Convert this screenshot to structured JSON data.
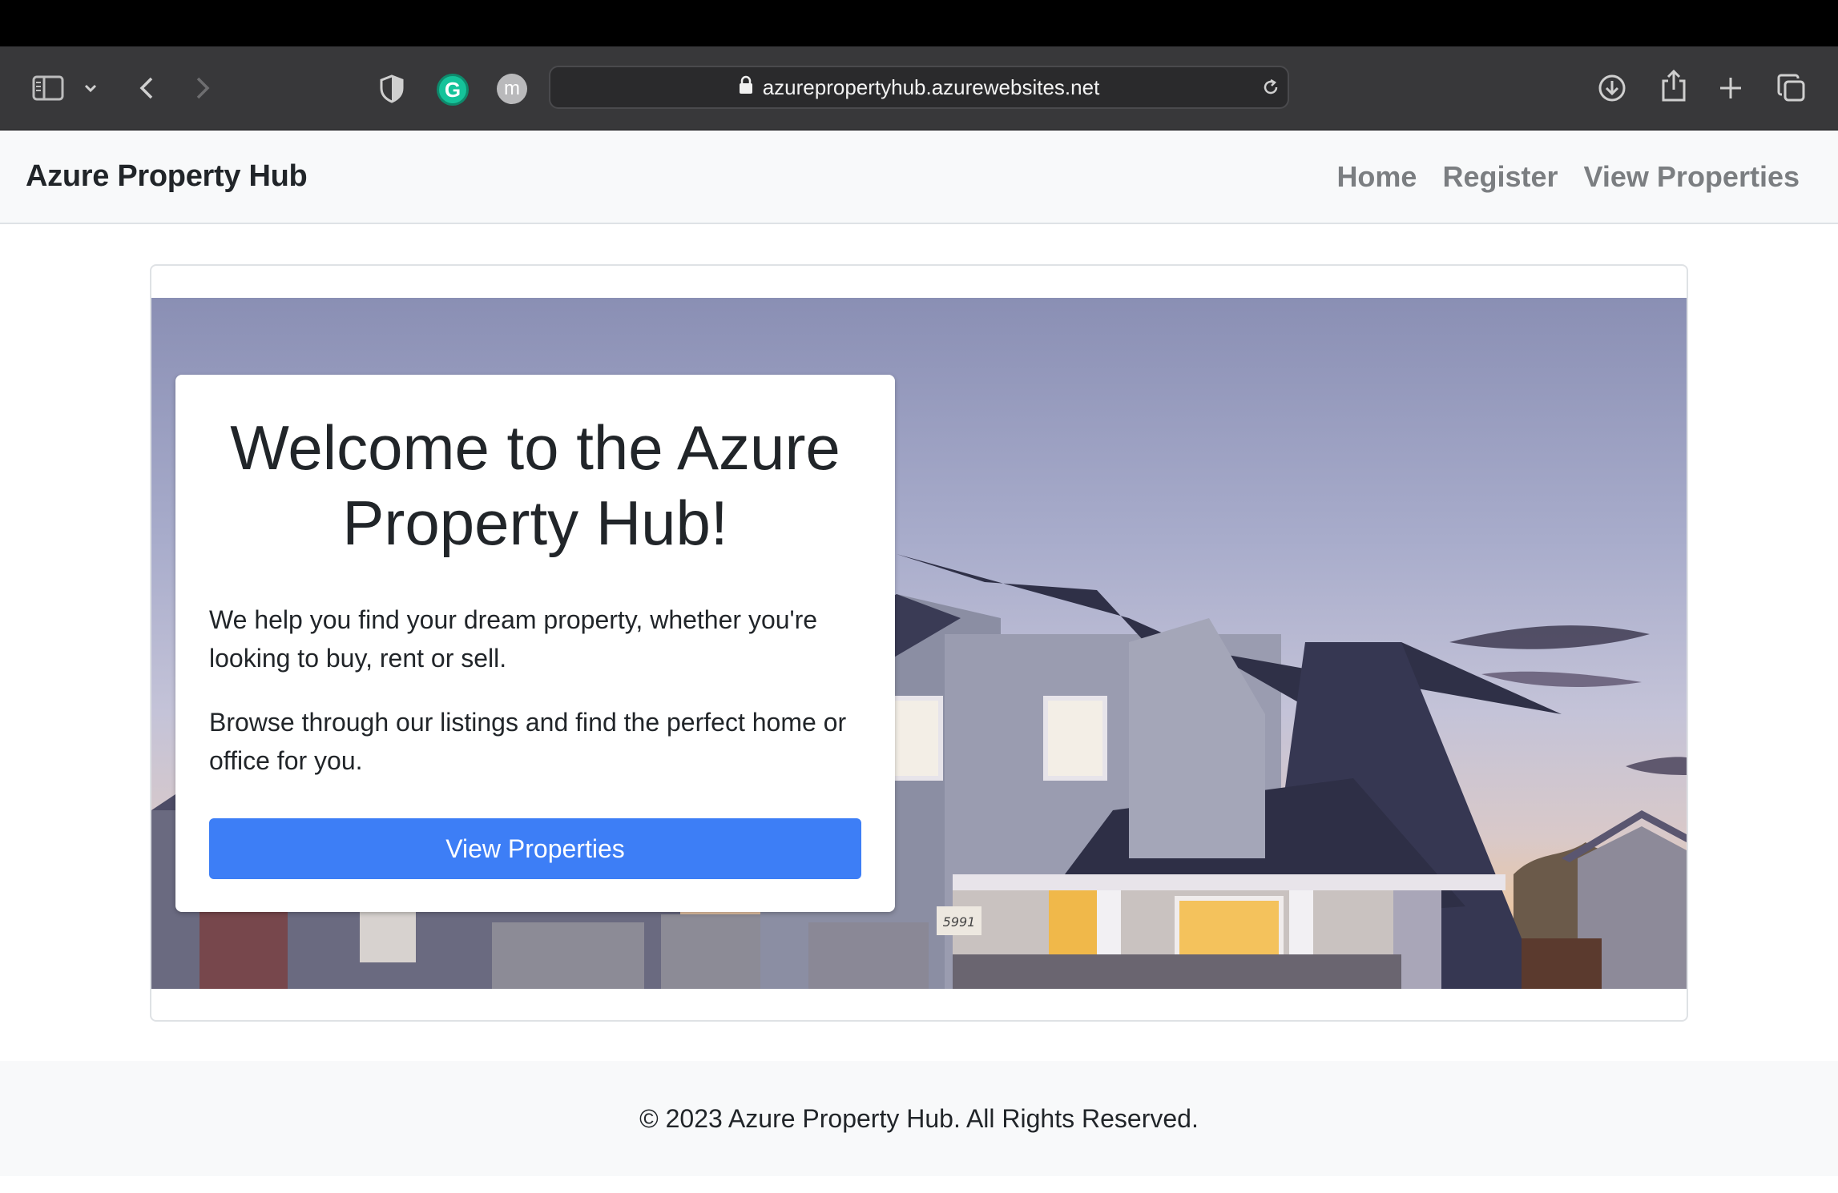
{
  "browser": {
    "url": "azurepropertyhub.azurewebsites.net",
    "extension_g_label": "G",
    "extension_m_label": "m",
    "icons": [
      "sidebar-icon",
      "chevron-down-icon",
      "back-icon",
      "forward-icon",
      "shield-icon",
      "lock-icon",
      "reload-icon",
      "download-icon",
      "share-icon",
      "new-tab-icon",
      "tab-overview-icon"
    ]
  },
  "navbar": {
    "brand": "Azure Property Hub",
    "links": [
      "Home",
      "Register",
      "View Properties"
    ]
  },
  "hero": {
    "heading": "Welcome to the Azure Property Hub!",
    "paragraph1": "We help you find your dream property, whether you're looking to buy, rent or sell.",
    "paragraph2": "Browse through our listings and find the perfect home or office for you.",
    "button_label": "View Properties",
    "house_number": "5991"
  },
  "footer": {
    "text": "© 2023 Azure Property Hub. All Rights Reserved."
  },
  "colors": {
    "primary_button": "#3d7ef6",
    "navbar_bg": "#f8f9fa",
    "nav_link": "#7b7e81",
    "toolbar_bg": "#38383a"
  }
}
